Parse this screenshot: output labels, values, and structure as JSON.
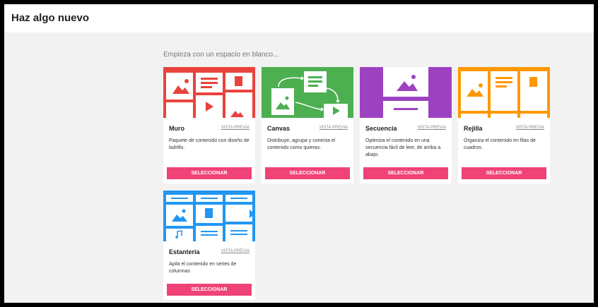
{
  "page": {
    "title": "Haz algo nuevo"
  },
  "main": {
    "subtitle": "Empieza con un espacio en blanco..."
  },
  "cards": [
    {
      "title": "Muro",
      "preview_label": "VISTA PREVIA",
      "description": "Paquete de contenido con diseño de ladrillo.",
      "button_label": "SELECCIONAR",
      "color": "#e8433c"
    },
    {
      "title": "Canvas",
      "preview_label": "VISTA PREVIA",
      "description": "Distribuye, agrupa y conecta el contenido como quieras.",
      "button_label": "SELECCIONAR",
      "color": "#4caf50"
    },
    {
      "title": "Secuencia",
      "preview_label": "VISTA PREVIA",
      "description": "Optimiza el contenido en una secuencia fácil de leer, de arriba a abajo.",
      "button_label": "SELECCIONAR",
      "color": "#9c42c0"
    },
    {
      "title": "Rejilla",
      "preview_label": "VISTA PREVIA",
      "description": "Organiza el contenido en filas de cuadros.",
      "button_label": "SELECCIONAR",
      "color": "#ff9800"
    },
    {
      "title": "Estantería",
      "preview_label": "VISTA PREVIA",
      "description": "Apila el contenido en series de columnas",
      "button_label": "SELECCIONAR",
      "color": "#2196f3"
    }
  ]
}
